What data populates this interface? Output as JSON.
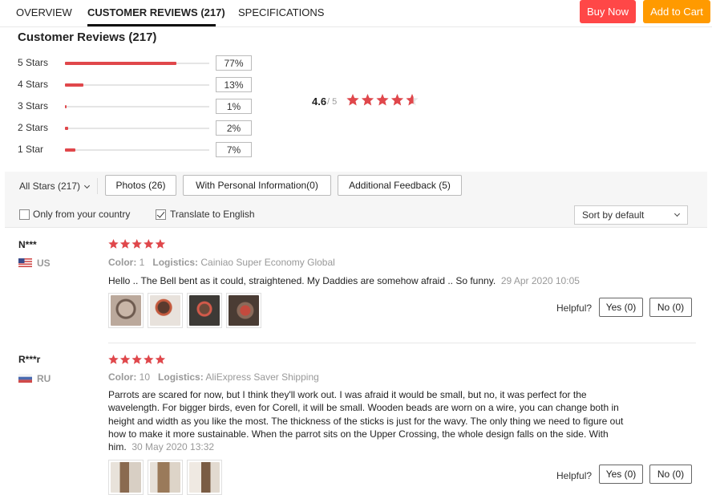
{
  "tabs": [
    {
      "label": "OVERVIEW"
    },
    {
      "label": "CUSTOMER REVIEWS (217)"
    },
    {
      "label": "SPECIFICATIONS"
    }
  ],
  "actions": {
    "buy_now": "Buy Now",
    "add_to_cart": "Add to Cart"
  },
  "colors": {
    "accent_red": "#ff4747",
    "accent_orange": "#ff9a00",
    "star_red": "#e0474b"
  },
  "summary": {
    "title": "Customer Reviews (217)",
    "average": "4.6",
    "out_of": "/ 5",
    "average_value": 4.6,
    "distribution": [
      {
        "label": "5 Stars",
        "pct": "77%",
        "fraction": 0.77
      },
      {
        "label": "4 Stars",
        "pct": "13%",
        "fraction": 0.13
      },
      {
        "label": "3 Stars",
        "pct": "1%",
        "fraction": 0.01
      },
      {
        "label": "2 Stars",
        "pct": "2%",
        "fraction": 0.02
      },
      {
        "label": "1 Star",
        "pct": "7%",
        "fraction": 0.07
      }
    ]
  },
  "filters": {
    "all_stars": "All Stars (217)",
    "photos": "Photos (26)",
    "with_personal_info": "With Personal Information(0)",
    "additional_feedback": "Additional Feedback (5)",
    "only_country": "Only from your country",
    "only_country_checked": false,
    "translate": "Translate to English",
    "translate_checked": true,
    "sort": "Sort by default"
  },
  "reviews": [
    {
      "name": "N***",
      "country": "US",
      "rating": 5,
      "color_label": "Color:",
      "color_value": "1",
      "logistics_label": "Logistics:",
      "logistics_value": "Cainiao Super Economy Global",
      "text": "Hello .. The Bell bent as it could, straightened. My Daddies are somehow afraid .. So funny.",
      "date": "29 Apr 2020 10:05",
      "photo_count": 4,
      "helpful": "Helpful?",
      "yes": "Yes (0)",
      "no": "No (0)"
    },
    {
      "name": "R***r",
      "country": "RU",
      "rating": 5,
      "color_label": "Color:",
      "color_value": "10",
      "logistics_label": "Logistics:",
      "logistics_value": "AliExpress Saver Shipping",
      "text": "Parrots are scared for now, but I think they'll work out. I was afraid it would be small, but no, it was perfect for the wavelength. For bigger birds, even for Corell, it will be small. Wooden beads are worn on a wire, you can change both in height and width as you like the most. The thickness of the sticks is just for the wavy. The only thing we need to figure out how to make it more sustainable. When the parrot sits on the Upper Crossing, the whole design falls on the side. With him.",
      "date": "30 May 2020 13:32",
      "photo_count": 3,
      "helpful": "Helpful?",
      "yes": "Yes (0)",
      "no": "No (0)"
    }
  ]
}
